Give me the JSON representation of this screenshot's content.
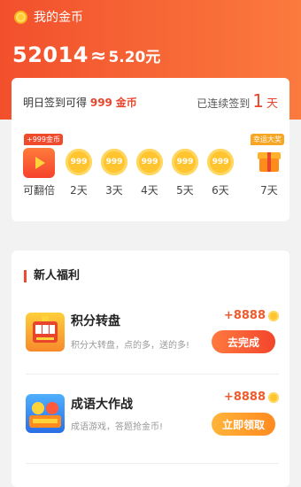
{
  "header": {
    "title": "我的金币",
    "balance_coins": "52014",
    "approx": "≈",
    "balance_yuan": "5.20元"
  },
  "signin": {
    "tomorrow_prefix": "明日签到可得",
    "tomorrow_amount": "999",
    "tomorrow_unit": "金币",
    "streak_prefix": "已连续签到",
    "streak_days": "1",
    "streak_unit": "天",
    "badge_left": "+999金币",
    "badge_right": "幸运大奖",
    "first_label": "可翻倍",
    "coin_value": "999",
    "days": [
      "2天",
      "3天",
      "4天",
      "5天",
      "6天",
      "7天"
    ]
  },
  "welfare": {
    "title": "新人福利",
    "tasks": [
      {
        "name": "积分转盘",
        "desc": "积分大转盘，点的多，送的多!",
        "reward": "+8888",
        "button": "去完成"
      },
      {
        "name": "成语大作战",
        "desc": "成语游戏，答题抢金币!",
        "reward": "+8888",
        "button": "立即领取"
      }
    ]
  },
  "colors": {
    "brand_red": "#f2502c",
    "accent_orange": "#fb7a3e",
    "coin_gold": "#ffc42e"
  }
}
